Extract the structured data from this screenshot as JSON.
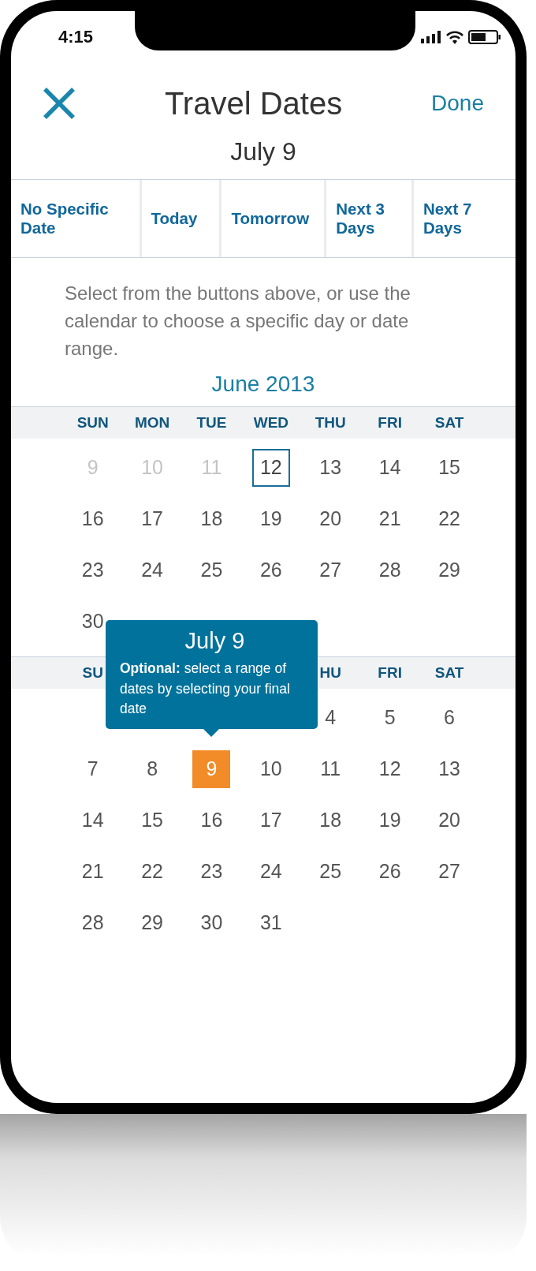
{
  "status_bar": {
    "time": "4:15"
  },
  "header": {
    "title": "Travel Dates",
    "done": "Done",
    "subtitle": "July 9"
  },
  "shortcuts": [
    {
      "label": "No Specific Date",
      "selected": false
    },
    {
      "label": "Today",
      "selected": false
    },
    {
      "label": "Tomorrow",
      "selected": false
    },
    {
      "label": "Next 3 Days",
      "selected": false
    },
    {
      "label": "Next 7 Days",
      "selected": false
    }
  ],
  "instructions": "Select from the buttons above, or use the calendar to choose a specific day or date range.",
  "months": [
    {
      "title": "June 2013",
      "weekdays": [
        {
          "label": "SUN",
          "kind": "sun"
        },
        {
          "label": "MON",
          "kind": "mon"
        },
        {
          "label": "TUE",
          "kind": "tue"
        },
        {
          "label": "WED",
          "kind": "wed"
        },
        {
          "label": "THU",
          "kind": "thu"
        },
        {
          "label": "FRI",
          "kind": "fri"
        },
        {
          "label": "SAT",
          "kind": "sat"
        }
      ],
      "weeks": [
        {
          "days": [
            {
              "label": "9",
              "kind": "past"
            },
            {
              "label": "10",
              "kind": "past"
            },
            {
              "label": "11",
              "kind": "past"
            },
            {
              "label": "12",
              "kind": "today"
            },
            {
              "label": "13",
              "kind": "normal"
            },
            {
              "label": "14",
              "kind": "normal"
            },
            {
              "label": "15",
              "kind": "normal"
            }
          ]
        },
        {
          "days": [
            {
              "label": "16",
              "kind": "normal"
            },
            {
              "label": "17",
              "kind": "normal"
            },
            {
              "label": "18",
              "kind": "normal"
            },
            {
              "label": "19",
              "kind": "normal"
            },
            {
              "label": "20",
              "kind": "normal"
            },
            {
              "label": "21",
              "kind": "normal"
            },
            {
              "label": "22",
              "kind": "normal"
            }
          ]
        },
        {
          "days": [
            {
              "label": "23",
              "kind": "normal"
            },
            {
              "label": "24",
              "kind": "normal"
            },
            {
              "label": "25",
              "kind": "normal"
            },
            {
              "label": "26",
              "kind": "normal"
            },
            {
              "label": "27",
              "kind": "normal"
            },
            {
              "label": "28",
              "kind": "normal"
            },
            {
              "label": "29",
              "kind": "normal"
            }
          ]
        },
        {
          "days": [
            {
              "label": "30",
              "kind": "normal"
            }
          ]
        }
      ]
    },
    {
      "weekdays": [
        {
          "label": "SU",
          "kind": "sun"
        },
        {
          "label": "HU",
          "kind": "thu"
        },
        {
          "label": "FRI",
          "kind": "fri"
        },
        {
          "label": "SAT",
          "kind": "sat"
        }
      ],
      "weeks": [
        {
          "kind": "thu",
          "days": [
            {
              "label": "4",
              "kind": "normal"
            },
            {
              "label": "5",
              "kind": "normal"
            },
            {
              "label": "6",
              "kind": "normal"
            }
          ]
        },
        {
          "days": [
            {
              "label": "7",
              "kind": "normal"
            },
            {
              "label": "8",
              "kind": "normal"
            },
            {
              "label": "9",
              "kind": "selected"
            },
            {
              "label": "10",
              "kind": "normal"
            },
            {
              "label": "11",
              "kind": "normal"
            },
            {
              "label": "12",
              "kind": "normal"
            },
            {
              "label": "13",
              "kind": "normal"
            }
          ]
        },
        {
          "days": [
            {
              "label": "14",
              "kind": "normal"
            },
            {
              "label": "15",
              "kind": "normal"
            },
            {
              "label": "16",
              "kind": "normal"
            },
            {
              "label": "17",
              "kind": "normal"
            },
            {
              "label": "18",
              "kind": "normal"
            },
            {
              "label": "19",
              "kind": "normal"
            },
            {
              "label": "20",
              "kind": "normal"
            }
          ]
        },
        {
          "days": [
            {
              "label": "21",
              "kind": "normal"
            },
            {
              "label": "22",
              "kind": "normal"
            },
            {
              "label": "23",
              "kind": "normal"
            },
            {
              "label": "24",
              "kind": "normal"
            },
            {
              "label": "25",
              "kind": "normal"
            },
            {
              "label": "26",
              "kind": "normal"
            },
            {
              "label": "27",
              "kind": "normal"
            }
          ]
        },
        {
          "days": [
            {
              "label": "28",
              "kind": "normal"
            },
            {
              "label": "29",
              "kind": "normal"
            },
            {
              "label": "30",
              "kind": "normal"
            },
            {
              "label": "31",
              "kind": "normal"
            }
          ]
        }
      ]
    }
  ],
  "tooltip": {
    "title": "July 9",
    "text": "**Optional:** select a range of dates by selecting your final date"
  }
}
